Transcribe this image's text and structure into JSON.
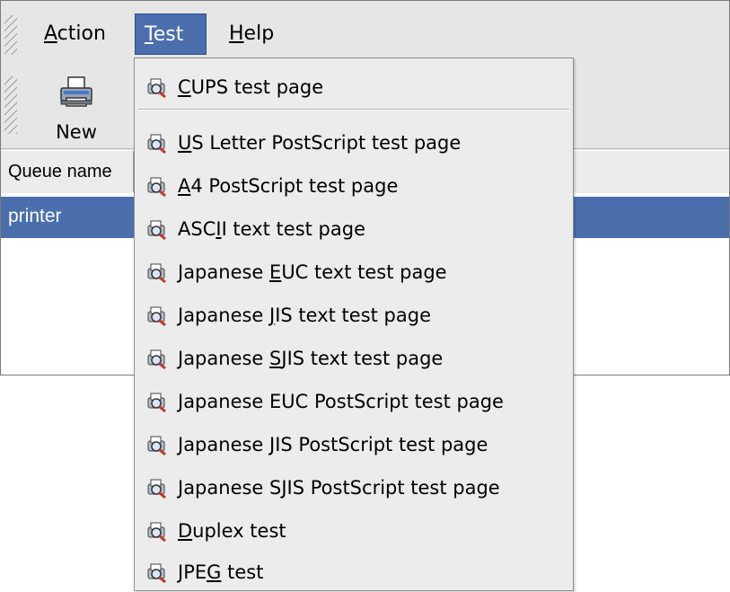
{
  "menubar": {
    "menus": [
      {
        "pre": "",
        "u": "A",
        "post": "ction"
      },
      {
        "pre": "",
        "u": "T",
        "post": "est"
      },
      {
        "pre": "",
        "u": "H",
        "post": "elp"
      }
    ]
  },
  "toolbar": {
    "new_label": "New",
    "new_icon": "printer-icon"
  },
  "table": {
    "columns": [
      "Queue name"
    ],
    "rows": [
      {
        "queue": "printer",
        "selected": true
      }
    ]
  },
  "test_menu": {
    "icon": "magnifier-page-icon",
    "items": [
      {
        "pre": "",
        "u": "C",
        "post": "UPS test page"
      },
      {
        "pre": "",
        "u": "U",
        "post": "S Letter PostScript test page"
      },
      {
        "pre": "",
        "u": "A",
        "post": "4 PostScript test page"
      },
      {
        "pre": "ASC",
        "u": "I",
        "post": "I text test page"
      },
      {
        "pre": "Japanese ",
        "u": "E",
        "post": "UC text test page"
      },
      {
        "pre": "Japanese ",
        "u": "J",
        "post": "IS text test page"
      },
      {
        "pre": "Japanese ",
        "u": "S",
        "post": "JIS text test page"
      },
      {
        "pre": "Japanese EUC PostScript test page",
        "u": "",
        "post": ""
      },
      {
        "pre": "Japanese JIS PostScript test page",
        "u": "",
        "post": ""
      },
      {
        "pre": "Japanese SJIS PostScript test page",
        "u": "",
        "post": ""
      },
      {
        "pre": "",
        "u": "D",
        "post": "uplex test"
      },
      {
        "pre": "JPE",
        "u": "G",
        "post": " test"
      }
    ]
  },
  "colors": {
    "selection": "#4b6fad",
    "menu_bg": "#ececec",
    "window_bg": "#e6e6e6"
  }
}
